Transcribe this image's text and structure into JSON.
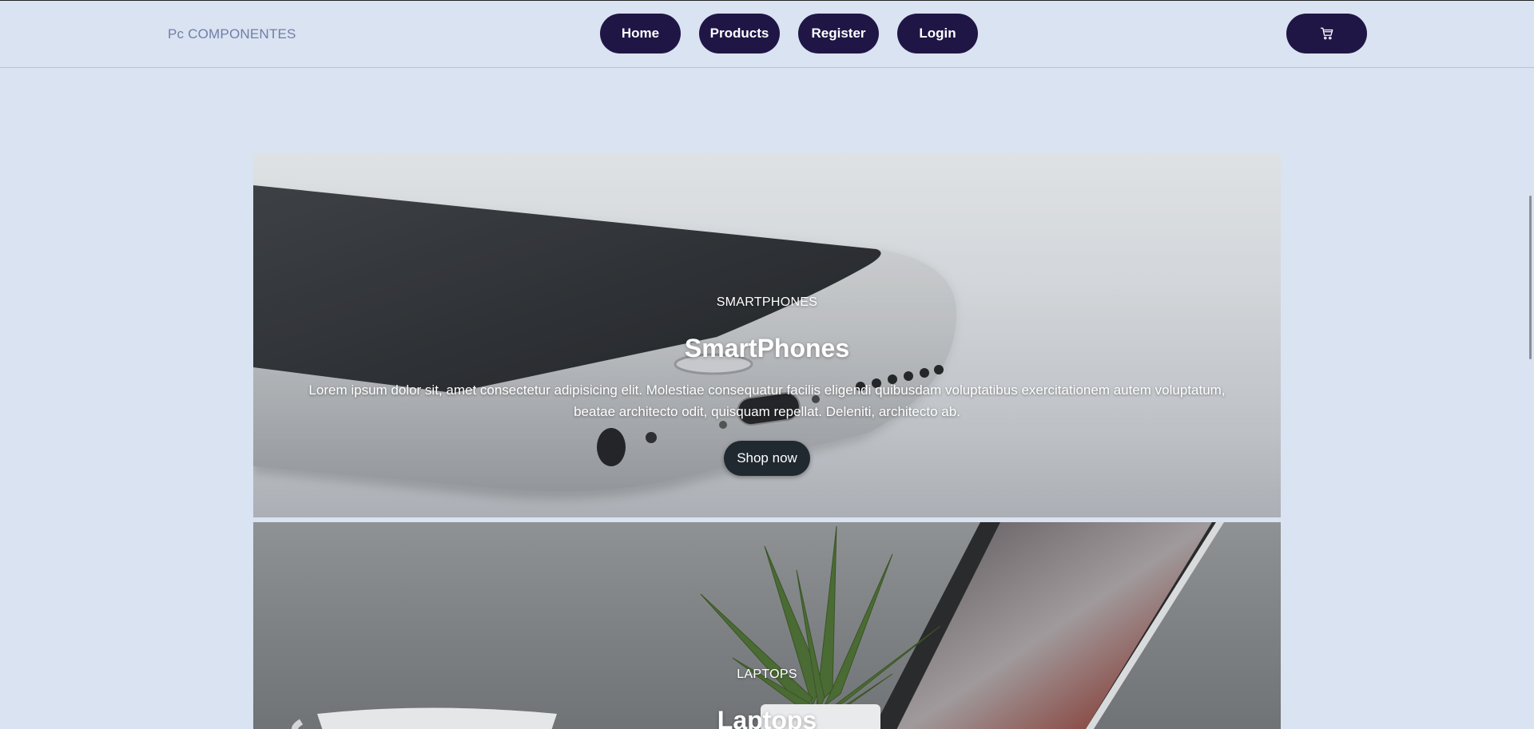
{
  "navbar": {
    "brand": "Pc COMPONENTES",
    "links": [
      {
        "label": "Home"
      },
      {
        "label": "Products"
      },
      {
        "label": "Register"
      },
      {
        "label": "Login"
      }
    ],
    "cart_icon": "cart-icon"
  },
  "cards": [
    {
      "eyebrow": "SMARTPHONES",
      "title": "SmartPhones",
      "description": "Lorem ipsum dolor sit, amet consectetur adipisicing elit. Molestiae consequatur facilis eligendi quibusdam voluptatibus exercitationem autem voluptatum, beatae architecto odit, quisquam repellat. Deleniti, architecto ab.",
      "button": "Shop now"
    },
    {
      "eyebrow": "LAPTOPS",
      "title": "Laptops"
    }
  ],
  "colors": {
    "background": "#dae3f2",
    "nav_button": "#1f1646",
    "shop_button": "#202830"
  }
}
